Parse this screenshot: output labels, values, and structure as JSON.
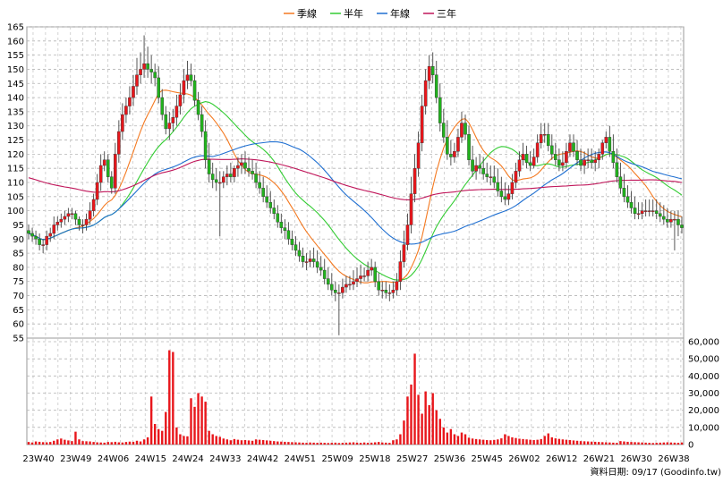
{
  "chart_data": {
    "type": "candlestick",
    "legend": [
      {
        "name": "季線",
        "color": "#f47920"
      },
      {
        "name": "半年",
        "color": "#33cc33"
      },
      {
        "name": "年線",
        "color": "#1f6fd1"
      },
      {
        "name": "三年",
        "color": "#c0165a"
      }
    ],
    "price_axis": {
      "min": 55,
      "max": 165,
      "step": 5
    },
    "volume_axis": {
      "min": 0,
      "max": 60000,
      "step": 10000,
      "tick_labels": [
        "0",
        "10,000",
        "20,000",
        "30,000",
        "40,000",
        "50,000",
        "60,000"
      ]
    },
    "x_labels": [
      "23W40",
      "23W49",
      "24W06",
      "24W15",
      "24W24",
      "24W33",
      "24W42",
      "24W51",
      "25W09",
      "25W18",
      "25W27",
      "25W36",
      "25W45",
      "26W02",
      "26W12",
      "26W21",
      "26W30",
      "26W38"
    ],
    "footer": "資料日期: 09/17  (Goodinfo.tw)",
    "grid": true,
    "candles": {
      "open": [
        93,
        92,
        91,
        90,
        88,
        88,
        91,
        92,
        95,
        96,
        97,
        98,
        99,
        99,
        97,
        95,
        95,
        97,
        100,
        104,
        110,
        116,
        118,
        112,
        108,
        120,
        128,
        134,
        137,
        140,
        144,
        148,
        150,
        152,
        150,
        149,
        147,
        140,
        134,
        129,
        131,
        133,
        137,
        141,
        146,
        148,
        146,
        139,
        134,
        128,
        118,
        113,
        111,
        110,
        110,
        112,
        113,
        112,
        115,
        116,
        117,
        115,
        114,
        113,
        110,
        108,
        105,
        103,
        101,
        99,
        96,
        94,
        93,
        90,
        88,
        86,
        84,
        82,
        82,
        83,
        82,
        80,
        79,
        76,
        74,
        72,
        71,
        71,
        73,
        74,
        74,
        75,
        76,
        77,
        77,
        79,
        80,
        75,
        72,
        72,
        71,
        71,
        72,
        75,
        82,
        88,
        95,
        106,
        115,
        124,
        137,
        146,
        151,
        148,
        140,
        131,
        126,
        120,
        119,
        121,
        126,
        131,
        127,
        118,
        114,
        116,
        115,
        113,
        112,
        112,
        110,
        107,
        105,
        104,
        106,
        110,
        114,
        118,
        120,
        117,
        116,
        119,
        124,
        127,
        127,
        123,
        120,
        118,
        116,
        117,
        121,
        124,
        121,
        118,
        116,
        118,
        118,
        117,
        118,
        120,
        124,
        126,
        121,
        117,
        112,
        108,
        105,
        103,
        101,
        99,
        99,
        100,
        100,
        100,
        100,
        99,
        98,
        97,
        96,
        97,
        97,
        95
      ],
      "close": [
        92,
        91,
        90,
        88,
        88,
        91,
        92,
        95,
        96,
        97,
        98,
        99,
        99,
        97,
        95,
        95,
        97,
        100,
        104,
        110,
        116,
        118,
        112,
        108,
        120,
        128,
        134,
        137,
        140,
        144,
        148,
        150,
        152,
        150,
        149,
        147,
        140,
        134,
        129,
        131,
        133,
        137,
        141,
        146,
        148,
        146,
        139,
        134,
        128,
        118,
        113,
        111,
        110,
        110,
        112,
        113,
        112,
        115,
        116,
        117,
        115,
        114,
        113,
        110,
        108,
        105,
        103,
        101,
        99,
        96,
        94,
        93,
        90,
        88,
        86,
        84,
        82,
        82,
        83,
        82,
        80,
        79,
        76,
        74,
        72,
        71,
        71,
        73,
        74,
        74,
        75,
        76,
        77,
        77,
        79,
        80,
        75,
        72,
        72,
        71,
        71,
        72,
        75,
        82,
        88,
        95,
        106,
        115,
        124,
        137,
        146,
        151,
        148,
        140,
        131,
        126,
        120,
        119,
        121,
        126,
        131,
        127,
        118,
        114,
        116,
        115,
        113,
        112,
        112,
        110,
        107,
        105,
        104,
        106,
        110,
        114,
        118,
        120,
        117,
        116,
        119,
        124,
        127,
        127,
        123,
        120,
        118,
        116,
        117,
        121,
        124,
        121,
        118,
        116,
        118,
        118,
        117,
        118,
        120,
        124,
        126,
        121,
        117,
        112,
        108,
        105,
        103,
        101,
        99,
        99,
        100,
        100,
        100,
        100,
        99,
        98,
        97,
        96,
        97,
        97,
        95,
        94
      ],
      "high": [
        95,
        94,
        93,
        92,
        90,
        93,
        94,
        98,
        98,
        99,
        100,
        101,
        101,
        100,
        98,
        97,
        99,
        103,
        106,
        113,
        120,
        121,
        120,
        114,
        124,
        132,
        138,
        140,
        144,
        148,
        154,
        156,
        162,
        158,
        155,
        152,
        151,
        143,
        137,
        135,
        136,
        141,
        145,
        150,
        153,
        152,
        148,
        142,
        137,
        132,
        124,
        117,
        115,
        114,
        114,
        116,
        117,
        116,
        119,
        120,
        121,
        119,
        118,
        117,
        114,
        112,
        109,
        107,
        104,
        102,
        99,
        97,
        96,
        93,
        91,
        89,
        87,
        85,
        86,
        87,
        86,
        84,
        83,
        80,
        78,
        75,
        74,
        76,
        77,
        77,
        79,
        80,
        81,
        80,
        82,
        83,
        82,
        78,
        75,
        75,
        74,
        75,
        78,
        86,
        93,
        99,
        112,
        120,
        128,
        141,
        150,
        155,
        156,
        153,
        145,
        136,
        132,
        125,
        124,
        129,
        135,
        134,
        130,
        123,
        119,
        120,
        119,
        117,
        116,
        116,
        115,
        112,
        110,
        109,
        113,
        117,
        121,
        124,
        123,
        121,
        122,
        127,
        131,
        131,
        131,
        127,
        124,
        122,
        121,
        124,
        127,
        127,
        125,
        122,
        121,
        122,
        122,
        121,
        122,
        125,
        128,
        130,
        127,
        122,
        117,
        113,
        109,
        107,
        105,
        103,
        103,
        104,
        104,
        104,
        104,
        103,
        102,
        101,
        100,
        100,
        100,
        98
      ],
      "low": [
        90,
        89,
        88,
        86,
        85,
        86,
        89,
        90,
        93,
        94,
        95,
        96,
        97,
        95,
        93,
        92,
        93,
        95,
        98,
        102,
        107,
        114,
        110,
        106,
        106,
        117,
        125,
        131,
        134,
        137,
        141,
        145,
        147,
        147,
        145,
        144,
        138,
        132,
        127,
        125,
        128,
        130,
        134,
        138,
        143,
        144,
        137,
        132,
        126,
        115,
        110,
        108,
        107,
        91,
        108,
        109,
        110,
        110,
        112,
        113,
        113,
        112,
        111,
        108,
        106,
        103,
        101,
        99,
        97,
        94,
        92,
        90,
        88,
        86,
        84,
        82,
        80,
        79,
        80,
        80,
        78,
        77,
        74,
        72,
        70,
        68,
        56,
        69,
        71,
        72,
        72,
        73,
        74,
        75,
        75,
        77,
        73,
        70,
        69,
        69,
        68,
        69,
        70,
        72,
        80,
        86,
        92,
        103,
        112,
        121,
        134,
        143,
        145,
        138,
        128,
        124,
        118,
        116,
        117,
        119,
        124,
        125,
        116,
        112,
        111,
        113,
        111,
        110,
        109,
        108,
        105,
        103,
        102,
        102,
        104,
        108,
        112,
        116,
        115,
        114,
        115,
        117,
        122,
        124,
        121,
        118,
        116,
        114,
        114,
        115,
        119,
        119,
        116,
        114,
        113,
        115,
        115,
        114,
        115,
        118,
        122,
        119,
        115,
        110,
        106,
        103,
        101,
        99,
        97,
        97,
        97,
        98,
        98,
        98,
        97,
        96,
        95,
        94,
        94,
        86,
        91,
        92
      ]
    },
    "volume": [
      1500,
      1200,
      1800,
      1600,
      1400,
      1300,
      1500,
      2200,
      3000,
      3500,
      2800,
      2400,
      2000,
      7500,
      3000,
      2000,
      1900,
      1800,
      1500,
      1300,
      1200,
      1100,
      1500,
      1400,
      1600,
      1300,
      1200,
      1500,
      1700,
      1600,
      2200,
      1800,
      3000,
      4200,
      28000,
      12000,
      9000,
      8000,
      19000,
      55000,
      54000,
      10000,
      6000,
      5000,
      4800,
      27000,
      22000,
      30000,
      28000,
      25000,
      8000,
      6000,
      5000,
      4500,
      3500,
      3000,
      2500,
      3200,
      2800,
      2500,
      2600,
      2400,
      2200,
      3000,
      2800,
      2600,
      2400,
      2200,
      2000,
      1800,
      1700,
      1600,
      1500,
      1400,
      1300,
      1200,
      1100,
      1000,
      1200,
      1100,
      1000,
      1100,
      1000,
      900,
      1000,
      1100,
      900,
      1000,
      1100,
      1200,
      1300,
      1100,
      1000,
      1200,
      1000,
      1100,
      1300,
      1500,
      1200,
      1100,
      1000,
      2500,
      3000,
      6000,
      14000,
      28000,
      35000,
      53000,
      29000,
      18000,
      31000,
      23000,
      30000,
      20000,
      15000,
      10000,
      7000,
      9000,
      6000,
      5000,
      7000,
      6000,
      4000,
      3500,
      3200,
      3000,
      2800,
      2600,
      2500,
      2700,
      3000,
      3600,
      6000,
      5000,
      4200,
      3800,
      3400,
      3200,
      3000,
      2800,
      2600,
      2800,
      3200,
      5000,
      6500,
      4200,
      3600,
      3300,
      3000,
      2800,
      2600,
      2400,
      2200,
      2000,
      1900,
      1800,
      1700,
      1600,
      1500,
      1400,
      1300,
      1200,
      1100,
      1000,
      2000,
      1800,
      1600,
      1500,
      1400,
      1300,
      1200,
      1100,
      1000,
      900,
      1000,
      1100,
      1200,
      1300,
      1200,
      1100,
      1000,
      1200,
      900,
      1000,
      1100,
      1200,
      1300,
      1400,
      1500,
      1600,
      2000,
      1800,
      1600,
      1500,
      1400,
      1600,
      1300,
      1200,
      1000,
      1100
    ]
  }
}
